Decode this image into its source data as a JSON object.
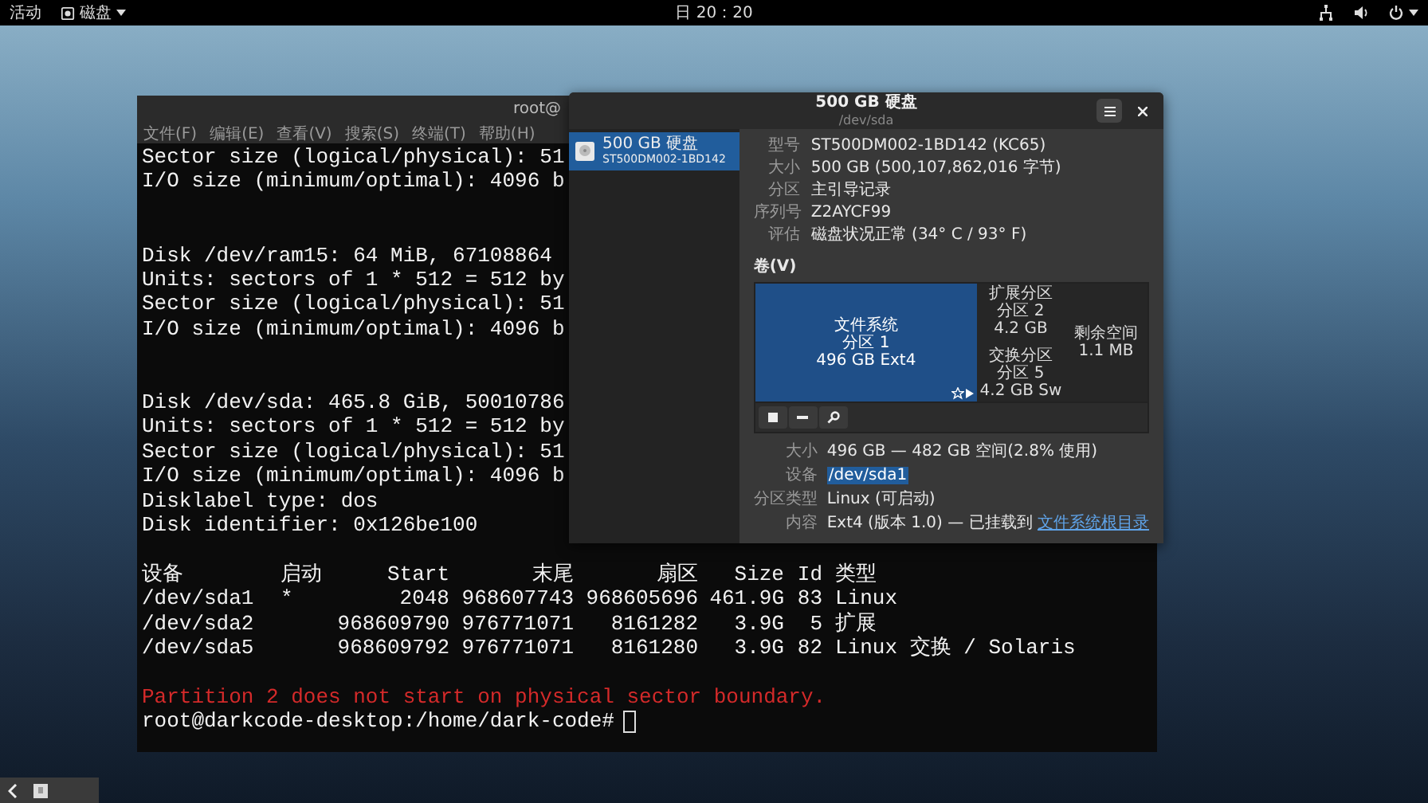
{
  "top_bar": {
    "activities": "活动",
    "app_menu": "磁盘",
    "clock": "日 20：20"
  },
  "terminal": {
    "title": "root@",
    "menu": [
      "文件(F)",
      "编辑(E)",
      "查看(V)",
      "搜索(S)",
      "终端(T)",
      "帮助(H)"
    ],
    "output_blocks": [
      [
        "Sector size (logical/physical): 51",
        "I/O size (minimum/optimal): 4096 b"
      ],
      [
        "Disk /dev/ram15: 64 MiB, 67108864",
        "Units: sectors of 1 * 512 = 512 by",
        "Sector size (logical/physical): 51",
        "I/O size (minimum/optimal): 4096 b"
      ],
      [
        "Disk /dev/sda: 465.8 GiB, 50010786",
        "Units: sectors of 1 * 512 = 512 by",
        "Sector size (logical/physical): 51",
        "I/O size (minimum/optimal): 4096 b",
        "Disklabel type: dos",
        "Disk identifier: 0x126be100"
      ]
    ],
    "table": {
      "columns": [
        "设备",
        "启动",
        "Start",
        "末尾",
        "扇区",
        "Size",
        "Id",
        "类型"
      ],
      "rows": [
        [
          "/dev/sda1",
          "*",
          "2048",
          "968607743",
          "968605696",
          "461.9G",
          "83",
          "Linux"
        ],
        [
          "/dev/sda2",
          "",
          "968609790",
          "976771071",
          "8161282",
          "3.9G",
          "5",
          "扩展"
        ],
        [
          "/dev/sda5",
          "",
          "968609792",
          "976771071",
          "8161280",
          "3.9G",
          "82",
          "Linux 交换 / Solaris"
        ]
      ]
    },
    "warning": "Partition 2 does not start on physical sector boundary.",
    "prompt": "root@darkcode-desktop:/home/dark-code#"
  },
  "disks_window": {
    "title": "500 GB 硬盘",
    "subtitle": "/dev/sda",
    "sidebar": [
      {
        "name": "500 GB 硬盘",
        "model": "ST500DM002-1BD142",
        "selected": true
      }
    ],
    "properties": [
      {
        "label": "型号",
        "value": "ST500DM002-1BD142 (KC65)"
      },
      {
        "label": "大小",
        "value": "500 GB (500,107,862,016 字节)"
      },
      {
        "label": "分区",
        "value": "主引导记录"
      },
      {
        "label": "序列号",
        "value": "Z2AYCF99"
      },
      {
        "label": "评估",
        "value": "磁盘状况正常 (34° C / 93° F)"
      }
    ],
    "volumes_label": "卷(V)",
    "volume_map": {
      "partitions": [
        {
          "kind": "primary",
          "lines": [
            "文件系统",
            "分区 1",
            "496 GB Ext4"
          ],
          "selected": true
        },
        {
          "kind": "extended",
          "lines": [
            "扩展分区",
            "分区 2",
            "4.2 GB"
          ],
          "selected": false,
          "children": [
            {
              "kind": "swap",
              "lines": [
                "交换分区",
                "分区 5",
                "4.2 GB Sw"
              ],
              "selected": false
            }
          ]
        },
        {
          "kind": "free",
          "lines": [
            "剩余空间",
            "1.1 MB"
          ],
          "selected": false
        }
      ]
    },
    "details": [
      {
        "label": "大小",
        "value": "496 GB — 482 GB 空间(2.8% 使用)",
        "highlighted": false
      },
      {
        "label": "设备",
        "value": "/dev/sda1",
        "highlighted": true
      },
      {
        "label": "分区类型",
        "value": "Linux (可启动)",
        "highlighted": false
      },
      {
        "label": "内容",
        "value": "Ext4 (版本 1.0) — 已挂载到",
        "link": "文件系统根目录",
        "highlighted": false
      }
    ]
  }
}
